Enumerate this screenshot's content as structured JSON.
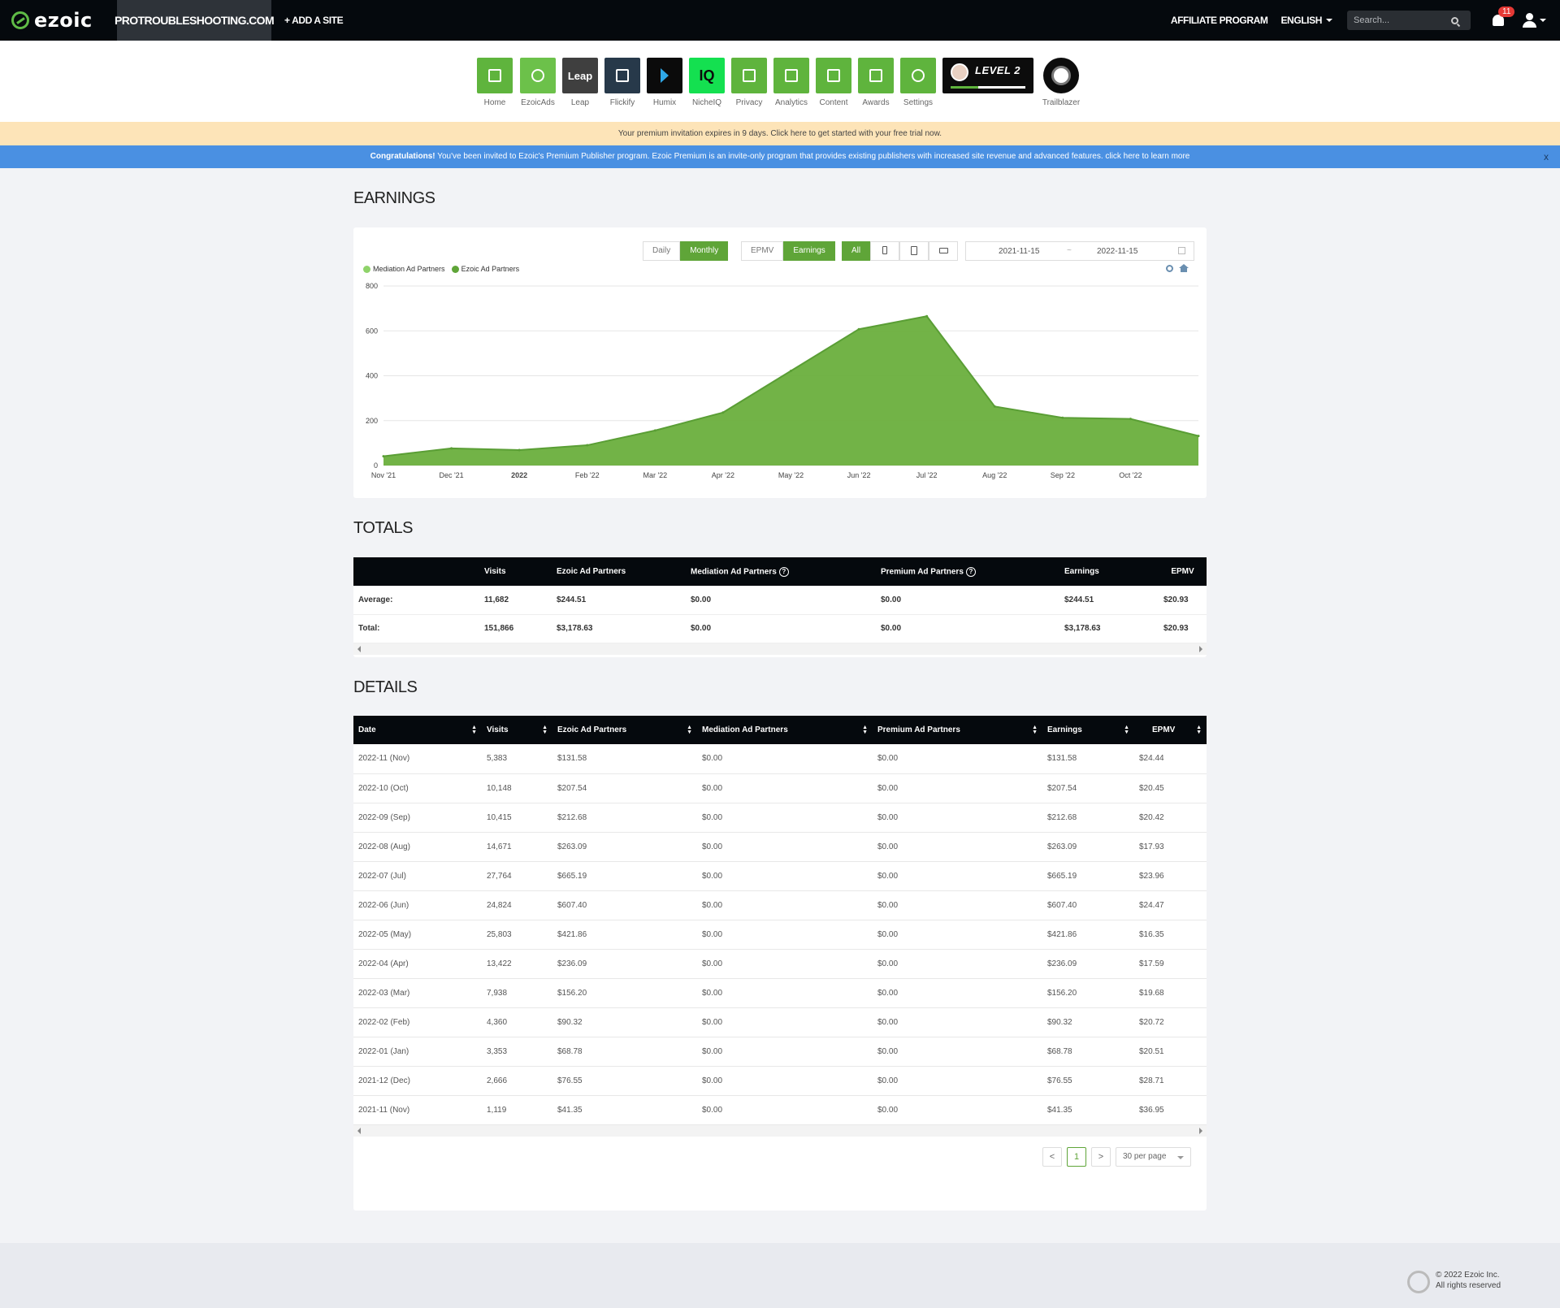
{
  "topbar": {
    "logo_text": "ezoic",
    "site_name": "PROTROUBLESHOOTING.COM",
    "add_site": "+ ADD A SITE",
    "affiliate": "AFFILIATE PROGRAM",
    "language": "ENGLISH",
    "search_placeholder": "Search...",
    "notification_count": "11"
  },
  "apps": [
    {
      "label": "Home",
      "icon": "home-icon",
      "color": "#5fb43d"
    },
    {
      "label": "EzoicAds",
      "icon": "ezoicads-icon",
      "color": "#6cc14a"
    },
    {
      "label": "Leap",
      "icon": "leap-icon",
      "color": "#3f3f3f",
      "tile_text": "Leap"
    },
    {
      "label": "Flickify",
      "icon": "flickify-icon",
      "color": "#27394a"
    },
    {
      "label": "Humix",
      "icon": "humix-icon",
      "color": "#0b0b0b"
    },
    {
      "label": "NicheIQ",
      "icon": "nicheiq-icon",
      "color": "#14e050",
      "tile_text": "IQ"
    },
    {
      "label": "Privacy",
      "icon": "shield-icon",
      "color": "#5fb43d"
    },
    {
      "label": "Analytics",
      "icon": "chart-icon",
      "color": "#5fb43d"
    },
    {
      "label": "Content",
      "icon": "content-icon",
      "color": "#5fb43d"
    },
    {
      "label": "Awards",
      "icon": "trophy-icon",
      "color": "#5fb43d"
    },
    {
      "label": "Settings",
      "icon": "gear-icon",
      "color": "#5fb43d"
    }
  ],
  "level": {
    "text": "LEVEL 2",
    "progress": 0.37
  },
  "trailblazer": {
    "label": "Trailblazer"
  },
  "banners": {
    "premium_trial": "Your premium invitation expires in 9 days. Click here to get started with your free trial now.",
    "congrats_bold": "Congratulations!",
    "congrats_text": " You've been invited to Ezoic's Premium Publisher program. Ezoic Premium is an invite-only program that provides existing publishers with increased site revenue and advanced features.",
    "congrats_link": " click here to learn more",
    "close": "x"
  },
  "earnings": {
    "title": "EARNINGS",
    "period_buttons": [
      "Daily",
      "Monthly"
    ],
    "active_period": "Monthly",
    "metric_buttons": [
      "EPMV",
      "Earnings"
    ],
    "active_metric": "Earnings",
    "device_all": "All",
    "date_from": "2021-11-15",
    "date_sep": "~",
    "date_to": "2022-11-15",
    "legend": [
      {
        "name": "Mediation Ad Partners",
        "color": "#8fd36a"
      },
      {
        "name": "Ezoic Ad Partners",
        "color": "#5fa538"
      }
    ]
  },
  "chart_data": {
    "type": "area",
    "x_ticks": [
      "Nov '21",
      "Dec '21",
      "2022",
      "Feb '22",
      "Mar '22",
      "Apr '22",
      "May '22",
      "Jun '22",
      "Jul '22",
      "Aug '22",
      "Sep '22",
      "Oct '22"
    ],
    "y_ticks": [
      "0",
      "200",
      "400",
      "600",
      "800"
    ],
    "ylim": [
      0,
      800
    ],
    "series": [
      {
        "name": "Ezoic Ad Partners",
        "color": "#6aaf3d",
        "values": [
          41.35,
          76.55,
          68.78,
          90.32,
          156.2,
          236.09,
          421.86,
          607.4,
          665.19,
          263.09,
          212.68,
          207.54,
          131.58
        ]
      },
      {
        "name": "Mediation Ad Partners",
        "color": "#8fd36a",
        "values": [
          0,
          0,
          0,
          0,
          0,
          0,
          0,
          0,
          0,
          0,
          0,
          0,
          0
        ]
      }
    ],
    "grid": true,
    "legend_position": "top-left"
  },
  "totals": {
    "title": "TOTALS",
    "headers": [
      "",
      "Visits",
      "Ezoic Ad Partners",
      "Mediation Ad Partners",
      "Premium Ad Partners",
      "Earnings",
      "EPMV"
    ],
    "rows": [
      [
        "Average:",
        "11,682",
        "$244.51",
        "$0.00",
        "$0.00",
        "$244.51",
        "$20.93"
      ],
      [
        "Total:",
        "151,866",
        "$3,178.63",
        "$0.00",
        "$0.00",
        "$3,178.63",
        "$20.93"
      ]
    ]
  },
  "details": {
    "title": "DETAILS",
    "headers": [
      "Date",
      "Visits",
      "Ezoic Ad Partners",
      "Mediation Ad Partners",
      "Premium Ad Partners",
      "Earnings",
      "EPMV"
    ],
    "rows": [
      [
        "2022-11 (Nov)",
        "5,383",
        "$131.58",
        "$0.00",
        "$0.00",
        "$131.58",
        "$24.44"
      ],
      [
        "2022-10 (Oct)",
        "10,148",
        "$207.54",
        "$0.00",
        "$0.00",
        "$207.54",
        "$20.45"
      ],
      [
        "2022-09 (Sep)",
        "10,415",
        "$212.68",
        "$0.00",
        "$0.00",
        "$212.68",
        "$20.42"
      ],
      [
        "2022-08 (Aug)",
        "14,671",
        "$263.09",
        "$0.00",
        "$0.00",
        "$263.09",
        "$17.93"
      ],
      [
        "2022-07 (Jul)",
        "27,764",
        "$665.19",
        "$0.00",
        "$0.00",
        "$665.19",
        "$23.96"
      ],
      [
        "2022-06 (Jun)",
        "24,824",
        "$607.40",
        "$0.00",
        "$0.00",
        "$607.40",
        "$24.47"
      ],
      [
        "2022-05 (May)",
        "25,803",
        "$421.86",
        "$0.00",
        "$0.00",
        "$421.86",
        "$16.35"
      ],
      [
        "2022-04 (Apr)",
        "13,422",
        "$236.09",
        "$0.00",
        "$0.00",
        "$236.09",
        "$17.59"
      ],
      [
        "2022-03 (Mar)",
        "7,938",
        "$156.20",
        "$0.00",
        "$0.00",
        "$156.20",
        "$19.68"
      ],
      [
        "2022-02 (Feb)",
        "4,360",
        "$90.32",
        "$0.00",
        "$0.00",
        "$90.32",
        "$20.72"
      ],
      [
        "2022-01 (Jan)",
        "3,353",
        "$68.78",
        "$0.00",
        "$0.00",
        "$68.78",
        "$20.51"
      ],
      [
        "2021-12 (Dec)",
        "2,666",
        "$76.55",
        "$0.00",
        "$0.00",
        "$76.55",
        "$28.71"
      ],
      [
        "2021-11 (Nov)",
        "1,119",
        "$41.35",
        "$0.00",
        "$0.00",
        "$41.35",
        "$36.95"
      ]
    ],
    "pager": {
      "prev": "<",
      "page": "1",
      "next": ">",
      "per_page": "30 per page"
    }
  },
  "footer": {
    "line1": "© 2022 Ezoic Inc.",
    "line2": "All rights reserved"
  }
}
